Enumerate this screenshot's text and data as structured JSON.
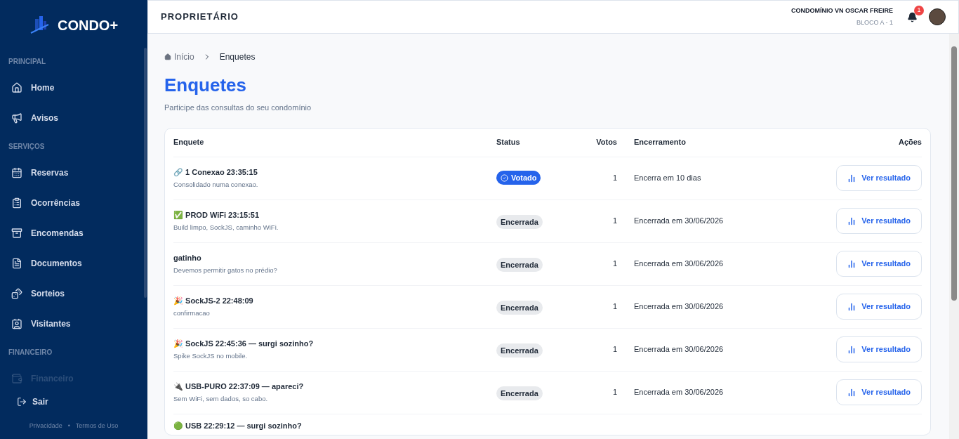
{
  "sidebar": {
    "logo": "CONDO+",
    "sections": [
      {
        "title": "PRINCIPAL",
        "items": [
          {
            "label": "Home",
            "faded": false
          },
          {
            "label": "Avisos",
            "faded": false
          }
        ]
      },
      {
        "title": "SERVIÇOS",
        "items": [
          {
            "label": "Reservas",
            "faded": false
          },
          {
            "label": "Ocorrências",
            "faded": false
          },
          {
            "label": "Encomendas",
            "faded": false
          },
          {
            "label": "Documentos",
            "faded": false
          },
          {
            "label": "Sorteios",
            "faded": false
          },
          {
            "label": "Visitantes",
            "faded": false
          }
        ]
      },
      {
        "title": "FINANCEIRO",
        "items": [
          {
            "label": "Financeiro",
            "faded": true
          }
        ]
      }
    ],
    "logout": "Sair",
    "footer_links": [
      "Privacidade",
      "Termos de Uso"
    ],
    "footer_separator": "•"
  },
  "header": {
    "role": "PROPRIETÁRIO",
    "condo": "CONDOMÍNIO VN OSCAR FREIRE",
    "unit": "BLOCO A - 1",
    "notifications": "1"
  },
  "breadcrumb": [
    "Início",
    "Enquetes"
  ],
  "page": {
    "title": "Enquetes",
    "subtitle": "Participe das consultas do seu condomínio"
  },
  "table": {
    "columns": [
      "Enquete",
      "Status",
      "Votos",
      "Encerramento",
      "Ações"
    ],
    "rows": [
      {
        "title": "🔗 1 Conexao 23:35:15",
        "description": "Consolidado numa conexao.",
        "status": "Votado",
        "kind": "voted",
        "votes": "1",
        "closing": "Encerra em 10 dias",
        "action": "Ver resultado"
      },
      {
        "title": "✅ PROD WiFi 23:15:51",
        "description": "Build limpo, SockJS, caminho WiFi.",
        "status": "Encerrada",
        "kind": "closed",
        "votes": "1",
        "closing": "Encerrada em 30/06/2026",
        "action": "Ver resultado"
      },
      {
        "title": "gatinho",
        "description": "Devemos permitir gatos no prédio?",
        "status": "Encerrada",
        "kind": "closed",
        "votes": "1",
        "closing": "Encerrada em 30/06/2026",
        "action": "Ver resultado"
      },
      {
        "title": "🎉 SockJS-2 22:48:09",
        "description": "confirmacao",
        "status": "Encerrada",
        "kind": "closed",
        "votes": "1",
        "closing": "Encerrada em 30/06/2026",
        "action": "Ver resultado"
      },
      {
        "title": "🎉 SockJS 22:45:36 — surgi sozinho?",
        "description": "Spike SockJS no mobile.",
        "status": "Encerrada",
        "kind": "closed",
        "votes": "1",
        "closing": "Encerrada em 30/06/2026",
        "action": "Ver resultado"
      },
      {
        "title": "🔌 USB-PURO 22:37:09 — apareci?",
        "description": "Sem WiFi, sem dados, so cabo.",
        "status": "Encerrada",
        "kind": "closed",
        "votes": "1",
        "closing": "Encerrada em 30/06/2026",
        "action": "Ver resultado"
      },
      {
        "title": "🟢 USB 22:29:12 — surgi sozinho?",
        "kind": "partial"
      }
    ]
  }
}
